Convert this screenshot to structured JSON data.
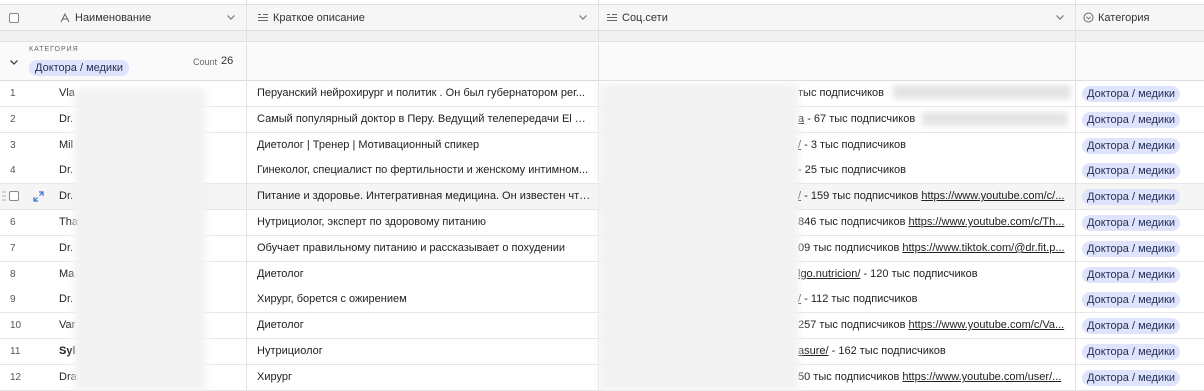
{
  "header": {
    "name_label": "Наименование",
    "desc_label": "Краткое описание",
    "social_label": "Соц.сети",
    "category_label": "Категория"
  },
  "group": {
    "caption": "КАТЕГОРИЯ",
    "value": "Доктора / медики",
    "count_label": "Count",
    "count": "26"
  },
  "rows": [
    {
      "num": "1",
      "name": "Vla",
      "desc": "Перуанский нейрохирург и политик . Он был губернатором рег...",
      "social": "тыс подписчиков",
      "social_link": "",
      "category": "Доктора / медики"
    },
    {
      "num": "2",
      "name": "Dr.",
      "desc": "Самый популярный доктор в Перу. Ведущий телепередачи El Dr....",
      "social": "- 67 тыс подписчиков",
      "social_link": "a",
      "category": "Доктора / медики"
    },
    {
      "num": "3",
      "name": "Mil",
      "desc": "Диетолог | Тренер | Мотивационный спикер",
      "social": "- 3 тыс подписчиков",
      "social_link": "/",
      "category": "Доктора / медики"
    },
    {
      "num": "4",
      "name": "Dr.",
      "desc": "Гинеколог, специалист по фертильности и женскому интимном...",
      "social": "- 25 тыс подписчиков",
      "social_link": "",
      "category": "Доктора / медики"
    },
    {
      "num": "",
      "name": "Dr.",
      "desc": "Питание и здоровье. Интегративная медицина. Он известен чте...",
      "social": "- 159 тыс подписчиков",
      "social_link": "/",
      "social_link2": "https://www.youtube.com/c/...",
      "category": "Доктора / медики"
    },
    {
      "num": "6",
      "name": "Tha",
      "desc": "Нутрициолог, эксперт по здоровому питанию",
      "social": "846 тыс подписчиков",
      "social_link": "",
      "social_link2": "https://www.youtube.com/c/Th...",
      "category": "Доктора / медики"
    },
    {
      "num": "7",
      "name": "Dr.",
      "desc": "Обучает правильному питанию и рассказывает о похудении",
      "social": "09 тыс подписчиков",
      "social_link": "",
      "social_link2": "https://www.tiktok.com/@dr.fit.p...",
      "category": "Доктора / медики"
    },
    {
      "num": "8",
      "name": "Ma",
      "desc": "Диетолог",
      "social": "- 120 тыс подписчиков",
      "social_link": "lgo.nutricion/",
      "category": "Доктора / медики"
    },
    {
      "num": "9",
      "name": "Dr.",
      "desc": "Хирург, борется с ожирением",
      "social": "- 112 тыс подписчиков",
      "social_link": "/",
      "category": "Доктора / медики"
    },
    {
      "num": "10",
      "name": "Var",
      "desc": "Диетолог",
      "social": "257 тыс подписчиков",
      "social_link": "",
      "social_link2": "https://www.youtube.com/c/Va...",
      "category": "Доктора / медики"
    },
    {
      "num": "11",
      "name": "Syl",
      "desc": "Нутрициолог",
      "social": "- 162 тыс подписчиков",
      "social_link": "asure/",
      "category": "Доктора / медики"
    },
    {
      "num": "12",
      "name": "Dra",
      "desc": "Хирург",
      "social": "50 тыс подписчиков",
      "social_link": "",
      "social_link2": "https://www.youtube.com/user/...",
      "category": "Доктора / медики"
    }
  ],
  "colors": {
    "tag_bg": "#dfe3fb",
    "tag_text": "#23305a",
    "header_bg": "#f6f6f6",
    "expand_icon": "#3a6fd8"
  }
}
